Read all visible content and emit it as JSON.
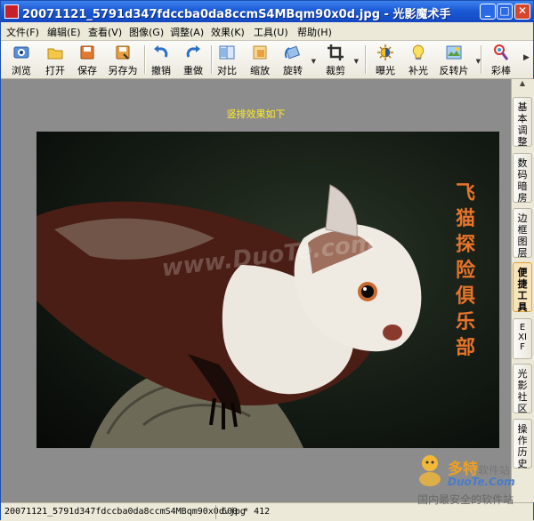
{
  "window": {
    "title": "20071121_5791d347fdccba0da8ccmS4MBqm90x0d.jpg - 光影魔术手",
    "minimize_label": "_",
    "maximize_label": "□",
    "close_label": "✕"
  },
  "menu": [
    {
      "label": "文件(F)"
    },
    {
      "label": "编辑(E)"
    },
    {
      "label": "查看(V)"
    },
    {
      "label": "图像(G)"
    },
    {
      "label": "调整(A)"
    },
    {
      "label": "效果(K)"
    },
    {
      "label": "工具(U)"
    },
    {
      "label": "帮助(H)"
    }
  ],
  "toolbar": [
    {
      "label": "浏览",
      "icon": "browse-icon"
    },
    {
      "label": "打开",
      "icon": "open-folder-icon"
    },
    {
      "label": "保存",
      "icon": "save-icon"
    },
    {
      "label": "另存为",
      "icon": "save-as-icon"
    },
    {
      "label": "撤销",
      "icon": "undo-icon"
    },
    {
      "label": "重做",
      "icon": "redo-icon"
    },
    {
      "label": "对比",
      "icon": "compare-icon"
    },
    {
      "label": "缩放",
      "icon": "zoom-icon"
    },
    {
      "label": "旋转",
      "icon": "rotate-icon"
    },
    {
      "label": "裁剪",
      "icon": "crop-icon"
    },
    {
      "label": "曝光",
      "icon": "exposure-icon"
    },
    {
      "label": "补光",
      "icon": "fill-light-icon"
    },
    {
      "label": "反转片",
      "icon": "reversal-film-icon"
    },
    {
      "label": "彩棒",
      "icon": "color-wand-icon"
    }
  ],
  "canvas": {
    "caption": "竖排效果如下",
    "overlay_vertical_text": "飞猫探险俱乐部",
    "watermark": "www.DuoTe.com"
  },
  "sidebar_tabs": [
    {
      "label": "基本调整",
      "active": false
    },
    {
      "label": "数码暗房",
      "active": false
    },
    {
      "label": "边框图层",
      "active": false
    },
    {
      "label": "便捷工具",
      "active": true
    },
    {
      "label": "EXIF",
      "active": false
    },
    {
      "label": "光影社区",
      "active": false
    },
    {
      "label": "操作历史",
      "active": false
    }
  ],
  "status": {
    "filename": "20071121_5791d347fdccba0da8ccmS4MBqm90x0d.jpg",
    "dimensions": "600 * 412"
  },
  "site_logo": {
    "name": "多特",
    "suffix": "软件站",
    "url": "DuoTe.Com",
    "slogan": "国内最安全的软件站"
  },
  "colors": {
    "caption": "#ffee22",
    "overlay_text": "#e8742a",
    "active_tab": "#f8e4b8"
  }
}
